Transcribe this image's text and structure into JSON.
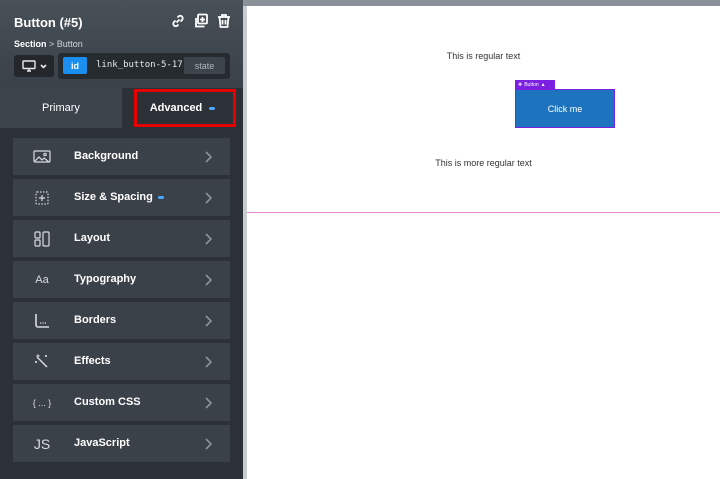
{
  "panel": {
    "title": "Button (#5)",
    "breadcrumb_parent": "Section",
    "breadcrumb_sep": " > ",
    "breadcrumb_current": "Button",
    "header_icons": [
      "link-icon",
      "duplicate-icon",
      "trash-icon"
    ],
    "device_icon": "desktop-icon",
    "id_badge": "id",
    "id_value": "link_button-5-17",
    "state_label": "state"
  },
  "tabs": {
    "primary": "Primary",
    "advanced": "Advanced"
  },
  "sections": [
    {
      "label": "Background",
      "icon": "background-icon",
      "modified": false
    },
    {
      "label": "Size & Spacing",
      "icon": "size-spacing-icon",
      "modified": true
    },
    {
      "label": "Layout",
      "icon": "layout-icon",
      "modified": false
    },
    {
      "label": "Typography",
      "icon": "typography-icon",
      "glyph": "Aa",
      "modified": false
    },
    {
      "label": "Borders",
      "icon": "borders-icon",
      "modified": false
    },
    {
      "label": "Effects",
      "icon": "effects-icon",
      "modified": false
    },
    {
      "label": "Custom CSS",
      "icon": "custom-css-icon",
      "glyph": "{ ... }",
      "modified": false
    },
    {
      "label": "JavaScript",
      "icon": "javascript-icon",
      "glyph": "JS",
      "modified": false
    }
  ],
  "canvas": {
    "regular_text": "This is regular text",
    "button_tag": "Button",
    "button_label": "Click me",
    "more_text": "This is more regular text"
  },
  "colors": {
    "panel_bg": "#2c3137",
    "accent_blue": "#1b8ff0",
    "highlight_red": "#e60000",
    "button_blue": "#1e73be",
    "selection_purple": "#7b1fe0"
  }
}
